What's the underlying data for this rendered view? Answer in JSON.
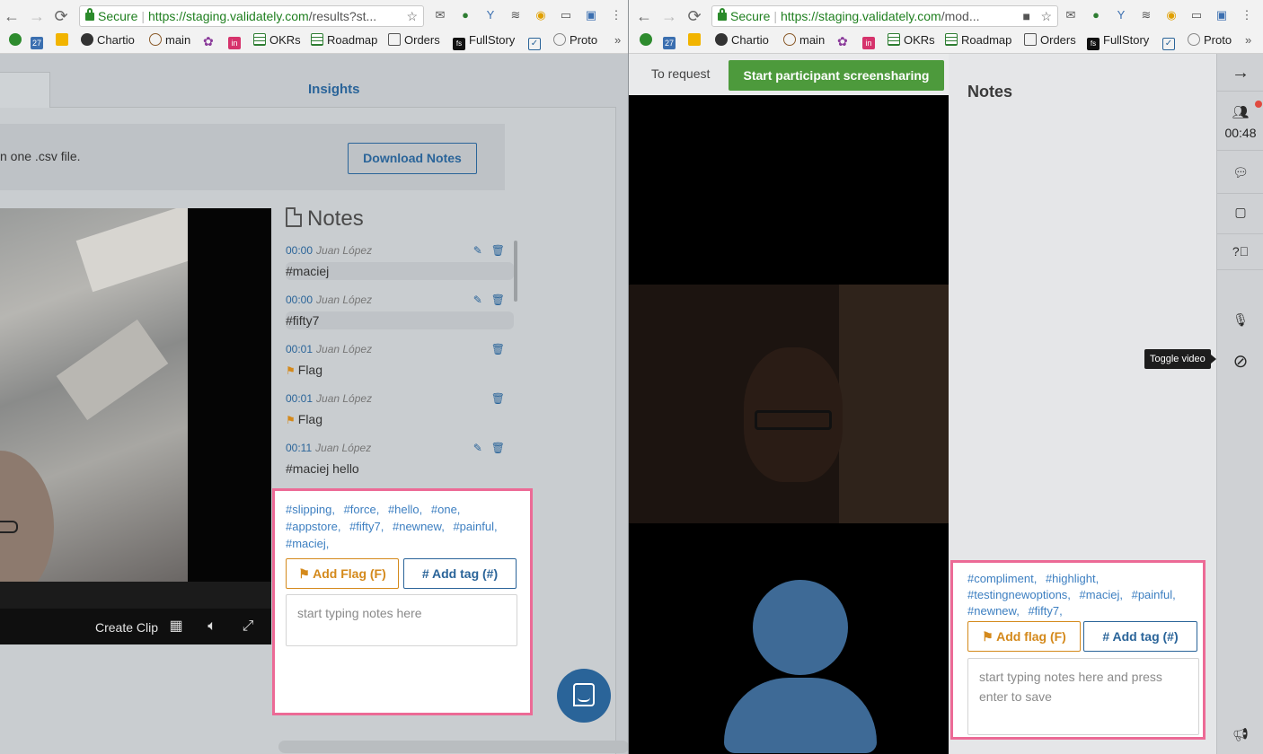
{
  "left_window": {
    "browser": {
      "secure_label": "Secure",
      "url_host": "https://staging.validately.com",
      "url_path": "/results?st...",
      "bookmarks": [
        "27",
        "Chartio",
        "main",
        "OKRs",
        "Roadmap",
        "Orders",
        "FullStory",
        "Proto"
      ]
    },
    "tabs": {
      "insights": "Insights"
    },
    "info_text": "n one .csv file.",
    "download_button": "Download Notes",
    "video": {
      "create_clip": "Create Clip"
    },
    "notes_title": "Notes",
    "notes": [
      {
        "time": "00:00",
        "author": "Juan López",
        "text": "#maciej",
        "editable": true
      },
      {
        "time": "00:00",
        "author": "Juan López",
        "text": "#fifty7",
        "editable": true
      },
      {
        "time": "00:01",
        "author": "Juan López",
        "text": "Flag",
        "flag": true,
        "editable": false
      },
      {
        "time": "00:01",
        "author": "Juan López",
        "text": "Flag",
        "flag": true,
        "editable": false
      },
      {
        "time": "00:11",
        "author": "Juan López",
        "text": "#maciej hello",
        "editable": true
      }
    ],
    "tags": [
      "#slipping,",
      "#force,",
      "#hello,",
      "#one,",
      "#appstore,",
      "#fifty7,",
      "#newnew,",
      "#painful,",
      "#maciej,"
    ],
    "add_flag_label": "Add Flag (F)",
    "add_tag_label": "Add tag (#)",
    "note_placeholder": "start typing notes here"
  },
  "right_window": {
    "browser": {
      "secure_label": "Secure",
      "url_host": "https://staging.validately.com",
      "url_path": "/mod...",
      "bookmarks": [
        "27",
        "Chartio",
        "main",
        "OKRs",
        "Roadmap",
        "Orders",
        "FullStory",
        "Proto"
      ]
    },
    "to_request": "To request",
    "start_screenshare": "Start participant screensharing",
    "notes_title": "Notes",
    "tags": [
      "#compliment,",
      "#highlight,",
      "#testingnewoptions,",
      "#maciej,",
      "#painful,",
      "#newnew,",
      "#fifty7,"
    ],
    "add_flag_label": "Add flag (F)",
    "add_tag_label": "Add tag (#)",
    "note_placeholder": "start typing notes here and press enter to save",
    "timer": "00:48",
    "tooltip": "Toggle video"
  },
  "colors": {
    "accent_blue": "#2a6499",
    "flag_orange": "#d4891b",
    "highlight_pink": "#ec6a96",
    "share_green": "#4d9a3c"
  }
}
